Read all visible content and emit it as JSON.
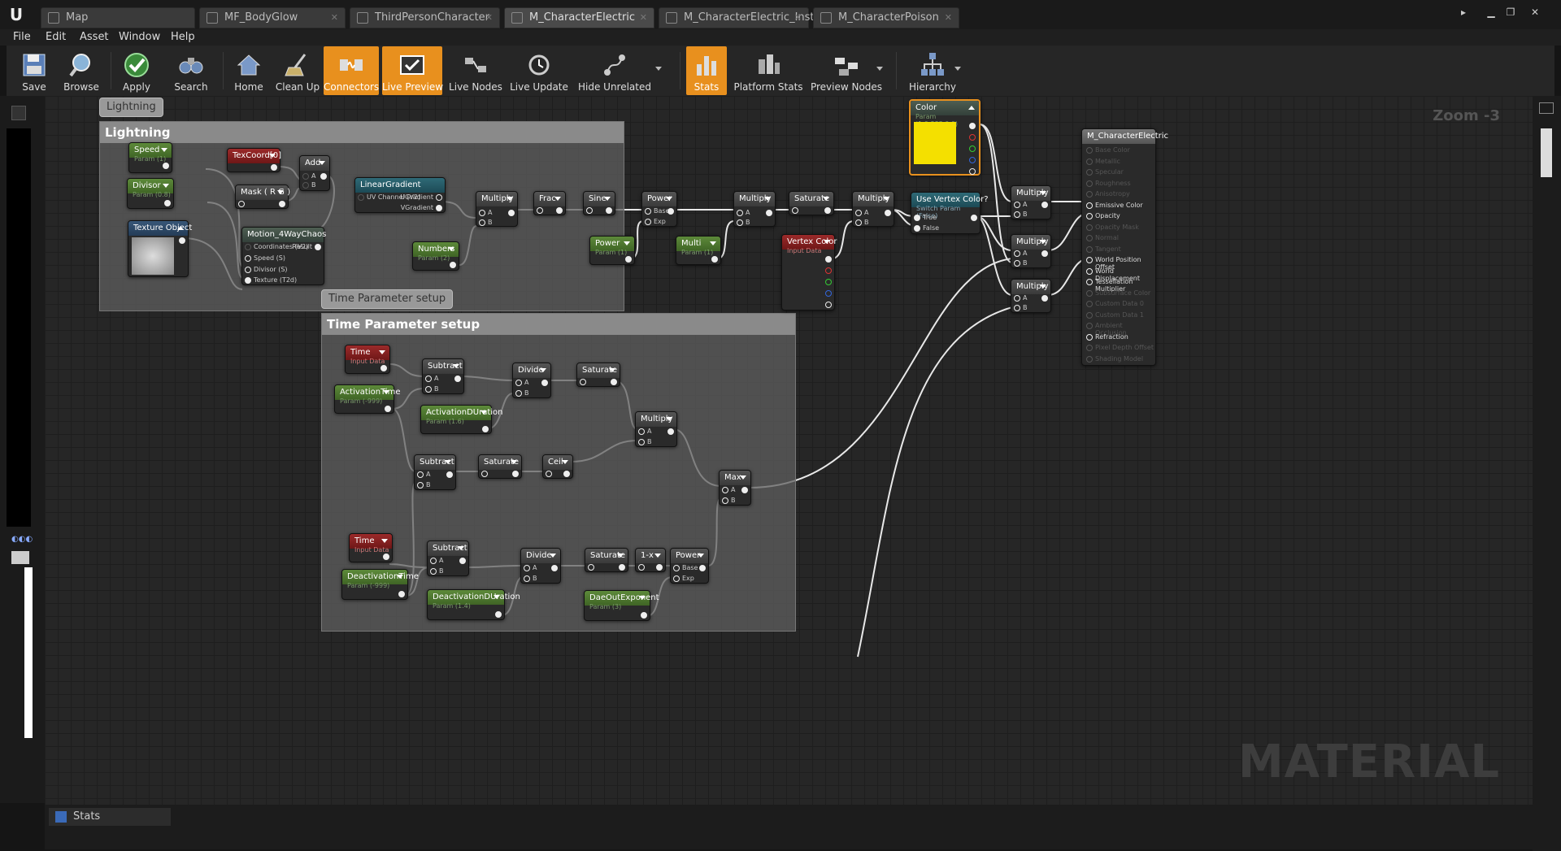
{
  "tabs": [
    "Map",
    "MF_BodyGlow",
    "ThirdPersonCharacter",
    "M_CharacterElectric",
    "M_CharacterElectric_Inst",
    "M_CharacterPoison"
  ],
  "menu": [
    "File",
    "Edit",
    "Asset",
    "Window",
    "Help"
  ],
  "toolbar": {
    "save": "Save",
    "browse": "Browse",
    "apply": "Apply",
    "search": "Search",
    "home": "Home",
    "clean_up": "Clean Up",
    "connectors": "Connectors",
    "live_preview": "Live Preview",
    "live_nodes": "Live Nodes",
    "live_update": "Live Update",
    "hide_unrelated": "Hide Unrelated",
    "stats": "Stats",
    "platform_stats": "Platform Stats",
    "preview_nodes": "Preview Nodes",
    "hierarchy": "Hierarchy"
  },
  "graph": {
    "zoom": "Zoom -3",
    "watermark": "MATERIAL",
    "comments": {
      "lightning_bubble": "Lightning",
      "lightning_title": "Lightning",
      "time_bubble": "Time Parameter setup",
      "time_title": "Time Parameter setup"
    },
    "nodes": {
      "speed": {
        "title": "Speed",
        "sub": "Param (1)"
      },
      "divisor": {
        "title": "Divisor",
        "sub": "Param (0.8)"
      },
      "texture_object": {
        "title": "Texture Object"
      },
      "texcoord": {
        "title": "TexCoord[0]"
      },
      "mask": {
        "title": "Mask ( R G )"
      },
      "add": {
        "title": "Add",
        "a": "A",
        "b": "B"
      },
      "motion": {
        "title": "Motion_4WayChaos",
        "p1": "Coordinates (V2)",
        "p2": "Speed (S)",
        "p3": "Divisor (S)",
        "p4": "Texture (T2d)",
        "out": "Result"
      },
      "linear_gradient": {
        "title": "LinearGradient",
        "in": "UV Channel (V2)",
        "o1": "UGradient",
        "o2": "VGradient"
      },
      "numbers": {
        "title": "Numbers",
        "sub": "Param (2)"
      },
      "multiply1": {
        "title": "Multiply"
      },
      "frac": {
        "title": "Frac"
      },
      "sine": {
        "title": "Sine"
      },
      "power1": {
        "title": "Power",
        "base": "Base",
        "exp": "Exp"
      },
      "power_param": {
        "title": "Power",
        "sub": "Param (1)"
      },
      "multi": {
        "title": "Multi",
        "sub": "Param (1)"
      },
      "multiply2": {
        "title": "Multiply"
      },
      "saturate1": {
        "title": "Saturate"
      },
      "multiply3": {
        "title": "Multiply"
      },
      "vertex_color": {
        "title": "Vertex Color",
        "sub": "Input Data"
      },
      "use_vertex": {
        "title": "Use Vertex Color?",
        "sub": "Switch Param (False)",
        "t": "True",
        "f": "False"
      },
      "color": {
        "title": "Color",
        "sub": "Param (1,0.883,0,0)",
        "swatch": "#f4e000"
      },
      "multiply4": {
        "title": "Multiply"
      },
      "multiply5": {
        "title": "Multiply"
      },
      "multiply6": {
        "title": "Multiply"
      },
      "result": {
        "title": "M_CharacterElectric",
        "pins": [
          "Base Color",
          "Metallic",
          "Specular",
          "Roughness",
          "Anisotropy",
          "Emissive Color",
          "Opacity",
          "Opacity Mask",
          "Normal",
          "Tangent",
          "World Position Offset",
          "World Displacement",
          "Tessellation Multiplier",
          "Subsurface Color",
          "Custom Data 0",
          "Custom Data 1",
          "Ambient Occlusion",
          "Refraction",
          "Pixel Depth Offset",
          "Shading Model"
        ]
      },
      "time1": {
        "title": "Time",
        "sub": "Input Data"
      },
      "activation_time": {
        "title": "ActivationTime",
        "sub": "Param (-999)"
      },
      "subtract1": {
        "title": "Subtract"
      },
      "activation_duration": {
        "title": "ActivationDUration",
        "sub": "Param (1.6)"
      },
      "divide1": {
        "title": "Divide"
      },
      "saturate2": {
        "title": "Saturate"
      },
      "multiply7": {
        "title": "Multiply"
      },
      "subtract2": {
        "title": "Subtract"
      },
      "saturate3": {
        "title": "Saturate"
      },
      "ceil": {
        "title": "Ceil"
      },
      "max": {
        "title": "Max"
      },
      "time2": {
        "title": "Time",
        "sub": "Input Data"
      },
      "deactivation_time": {
        "title": "DeactivationTime",
        "sub": "Param (-999)"
      },
      "subtract3": {
        "title": "Subtract"
      },
      "deactivation_duration": {
        "title": "DeactivationDUration",
        "sub": "Param (1.4)"
      },
      "divide2": {
        "title": "Divide"
      },
      "saturate4": {
        "title": "Saturate"
      },
      "one_minus": {
        "title": "1-x"
      },
      "power2": {
        "title": "Power",
        "base": "Base",
        "exp": "Exp"
      },
      "dae_exponent": {
        "title": "DaeOutExponent",
        "sub": "Param (3)"
      }
    }
  },
  "stats_tab": "Stats"
}
